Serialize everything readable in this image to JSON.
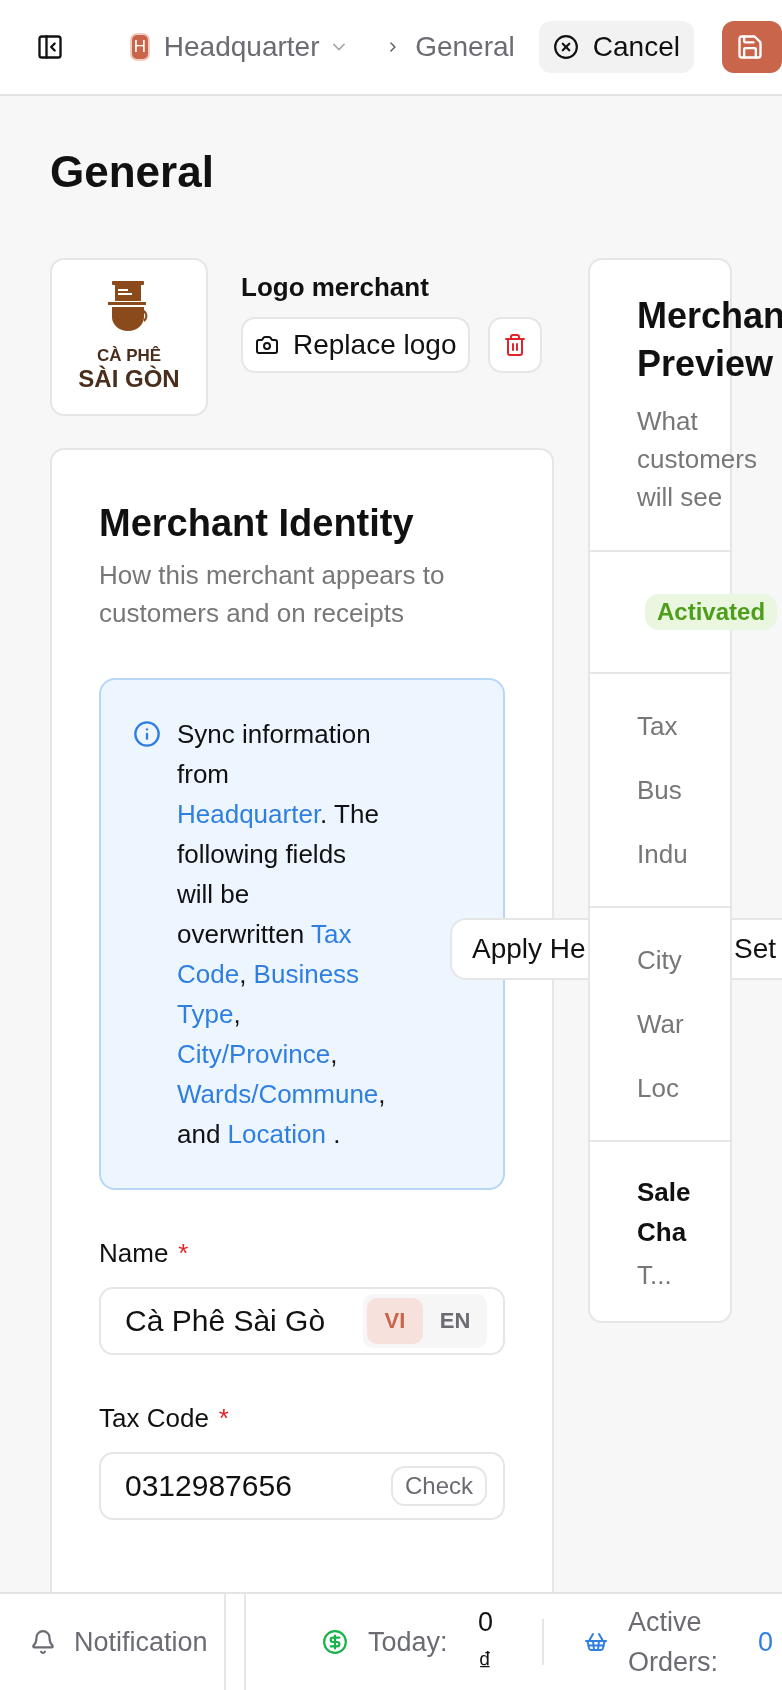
{
  "top_bar": {
    "workspace_initial": "H",
    "workspace_name": "Headquarter",
    "breadcrumb": "General",
    "cancel": "Cancel"
  },
  "page_title": "General",
  "logo": {
    "line_1": "CÀ PHÊ",
    "line_2": "SÀI GÒN",
    "label": "Logo merchant",
    "replace": "Replace logo"
  },
  "identity": {
    "title": "Merchant Identity",
    "subtitle": "How this merchant appears to customers and on receipts",
    "notice": [
      {
        "text": "Sync information from ",
        "highlight": false
      },
      {
        "text": "Headquarter",
        "highlight": true
      },
      {
        "text": ". The following fields will be overwritten ",
        "highlight": false
      },
      {
        "text": "Tax Code",
        "highlight": true
      },
      {
        "text": ", ",
        "highlight": false
      },
      {
        "text": "Business Type",
        "highlight": true
      },
      {
        "text": ", ",
        "highlight": false
      },
      {
        "text": "City/Province",
        "highlight": true
      },
      {
        "text": ", ",
        "highlight": false
      },
      {
        "text": "Wards/Commune",
        "highlight": true
      },
      {
        "text": ", and ",
        "highlight": false
      },
      {
        "text": "Location",
        "highlight": true
      },
      {
        "text": " .",
        "highlight": false
      }
    ],
    "fields": [
      {
        "kind": "language",
        "label": "Name",
        "required_mark": "*",
        "value": "Cà Phê Sài Gò",
        "languages": [
          {
            "code": "VI",
            "selected": true
          },
          {
            "code": "EN",
            "selected": false
          }
        ]
      },
      {
        "kind": "check",
        "label": "Tax Code",
        "required_mark": "*",
        "value": "0312987656",
        "action": "Check"
      }
    ]
  },
  "floating_actions": [
    "Apply He",
    "Set"
  ],
  "preview": {
    "title": "Merchan Preview",
    "subtitle": "What customers will see",
    "status": "Activated",
    "sections": [
      [
        "Tax",
        "Bus",
        "Indu"
      ],
      [
        "City",
        "War",
        "Loc"
      ]
    ],
    "channel": {
      "title": "Sale Cha",
      "value": "T..."
    }
  },
  "bottom_bar": {
    "notification": "Notification",
    "today_label": "Today:",
    "today_value": "0 ₫",
    "orders_label": "Active Orders:",
    "orders_value": "0"
  }
}
